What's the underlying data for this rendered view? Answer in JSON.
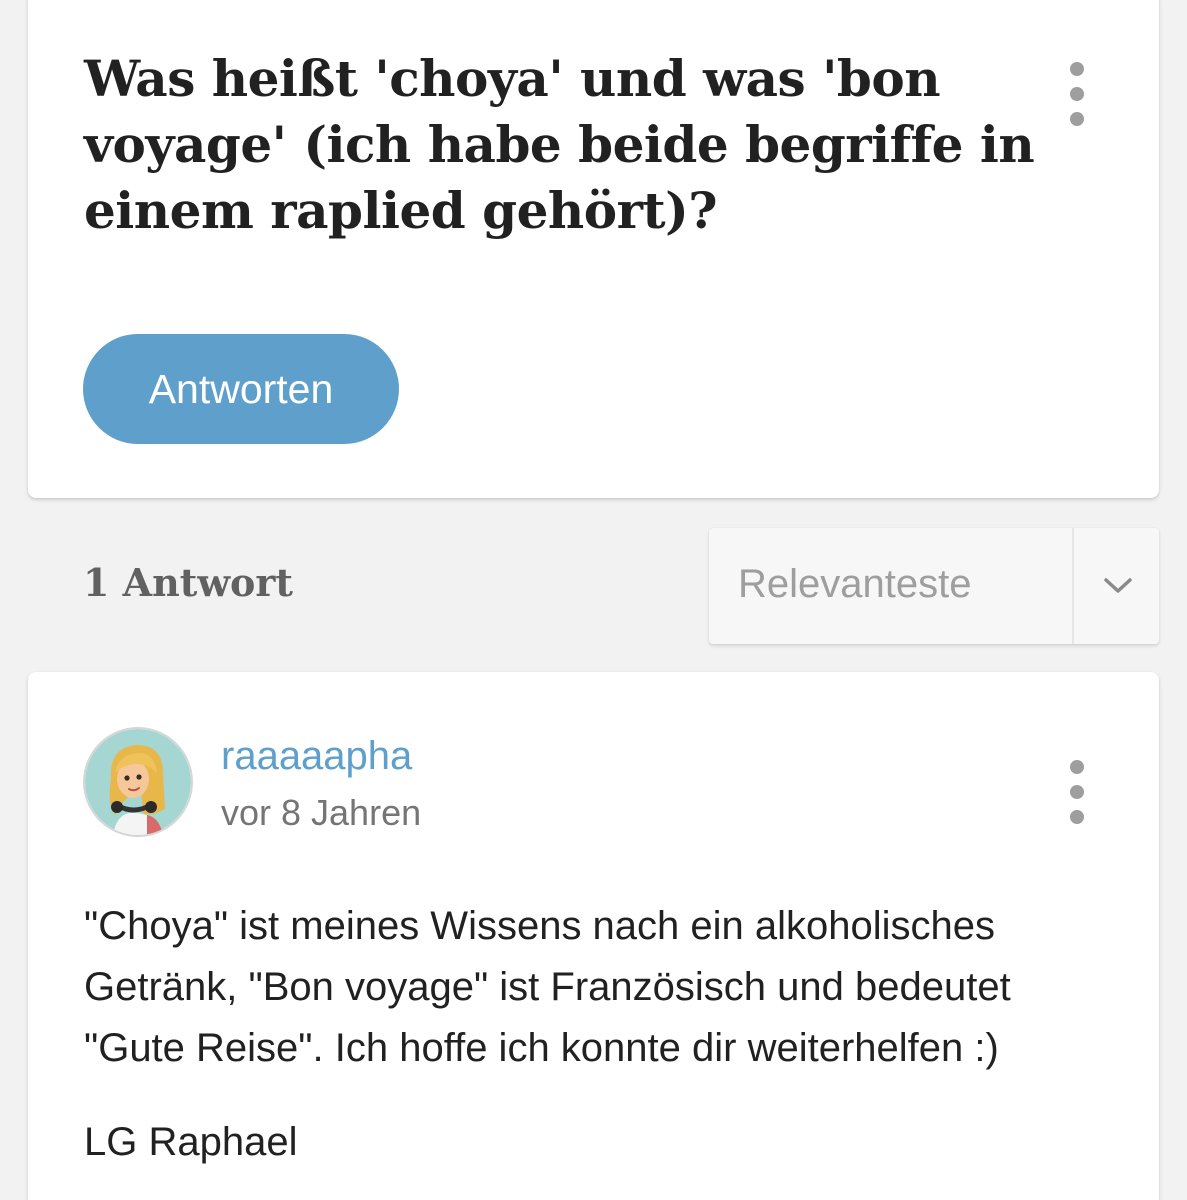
{
  "question": {
    "title": "Was heißt 'choya' und was 'bon voyage' (ich habe beide begriffe in einem raplied gehört)?",
    "menu_icon": "more-vertical-icon",
    "answer_button_label": "Antworten"
  },
  "answers_header": {
    "count_label": "1 Antwort",
    "sort_selected": "Relevanteste",
    "sort_icon": "chevron-down-icon"
  },
  "answer": {
    "avatar_icon": "user-avatar-illustration",
    "username": "raaaaapha",
    "timestamp": "vor 8 Jahren",
    "menu_icon": "more-vertical-icon",
    "text": "\"Choya\" ist meines Wissens nach ein alkoholisches Getränk, \"Bon voyage\" ist Französisch und bedeutet \"Gute Reise\". Ich hoffe ich konnte dir weiterhelfen :)",
    "signature": "LG Raphael"
  },
  "colors": {
    "background": "#f2f2f2",
    "card": "#ffffff",
    "accent_blue": "#5f9fcb",
    "title_text": "#212121",
    "muted_text": "#757575",
    "kebab_dots": "#9e9e9e"
  }
}
